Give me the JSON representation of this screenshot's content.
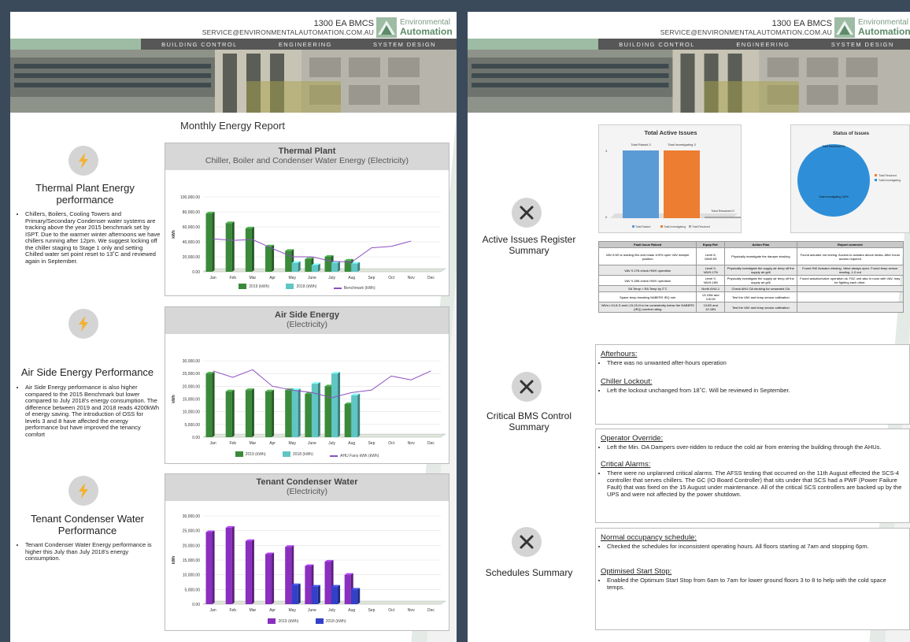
{
  "header": {
    "phone": "1300 EA BMCS",
    "email": "SERVICE@ENVIRONMENTALAUTOMATION.COM.AU",
    "logo_line1": "Environmental",
    "logo_line2": "Automation",
    "nav": [
      "BUILDING CONTROL",
      "ENGINEERING",
      "SYSTEM DESIGN"
    ]
  },
  "page1": {
    "title": "Monthly Energy Report",
    "sections": [
      {
        "icon": "lightning-icon",
        "title": "Thermal Plant Energy performance",
        "text": "Chillers, Boilers, Cooling Towers and Primary/Secondary Condenser water systems are tracking above the year 2015 benchmark set by ISPT. Due to the warmer winter afternoons we have chillers running after 12pm. We suggest locking off the chiller staging to Stage 1 only and setting Chilled water set point reset to 13˚C and reviewed again in September."
      },
      {
        "icon": "lightning-icon",
        "title": "Air Side Energy Performance",
        "text": "Air Side Energy performance is also higher compared to the 2015 Benchmark but lower compared to July 2018's energy consumption. The difference between 2019 and 2018 reads 4200kWh of energy saving. The introduction of OSS for levels 3 and 8 have affected the energy performance but have improved the tenancy comfort"
      },
      {
        "icon": "lightning-icon",
        "title": "Tenant Condenser Water Performance",
        "text": "Tenant Condenser Water Energy performance is higher this July than July 2018's energy consumption."
      }
    ]
  },
  "chart_data": [
    {
      "type": "bar",
      "title": "Thermal Plant",
      "subtitle": "Chiller, Boiler and Condenser Water Energy (Electricity)",
      "ylabel": "kWh",
      "ylim": [
        0,
        100000
      ],
      "yticks": [
        "100,000.00",
        "80,000.00",
        "60,000.00",
        "40,000.00",
        "20,000.00",
        "0.00"
      ],
      "categories": [
        "Jan",
        "Feb",
        "Mar",
        "Apr",
        "May",
        "June",
        "July",
        "Aug",
        "Sep",
        "Oct",
        "Nov",
        "Dec"
      ],
      "series": [
        {
          "name": "2019 (kWh)",
          "values": [
            78000,
            65000,
            58000,
            34000,
            28000,
            17000,
            20000,
            15000,
            null,
            null,
            null,
            null
          ],
          "color": "#3a8a3a"
        },
        {
          "name": "2018 (kWh)",
          "values": [
            null,
            null,
            null,
            null,
            12000,
            9000,
            12000,
            11000,
            null,
            null,
            null,
            null
          ],
          "color": "#5fc6c4"
        },
        {
          "name": "Benchmark (kWh)",
          "values": [
            44000,
            42000,
            43000,
            31000,
            20000,
            20000,
            14000,
            13000,
            32000,
            34000,
            41000,
            null
          ],
          "color": "#8b4fbf",
          "line": true
        }
      ],
      "legend": [
        "2019 (kWh)",
        "2018 (kWh)",
        "Benchmark (kWh)"
      ]
    },
    {
      "type": "bar",
      "title": "Air Side Energy",
      "subtitle": "(Electricity)",
      "ylabel": "kWh",
      "ylim": [
        0,
        30000
      ],
      "yticks": [
        "30,000.00",
        "25,000.00",
        "20,000.00",
        "15,000.00",
        "10,000.00",
        "5,000.00",
        "0.00"
      ],
      "categories": [
        "Jan",
        "Feb",
        "Mar",
        "Apr",
        "May",
        "June",
        "July",
        "Aug",
        "Sep",
        "Oct",
        "Nov",
        "Dec"
      ],
      "series": [
        {
          "name": "2019 (kWh)",
          "values": [
            25000,
            18000,
            18500,
            18000,
            18500,
            17000,
            20000,
            13000,
            null,
            null,
            null,
            null
          ],
          "color": "#3a8a3a"
        },
        {
          "name": "2018 (kWh)",
          "values": [
            null,
            null,
            null,
            null,
            18500,
            21000,
            25000,
            16500,
            null,
            null,
            null,
            null
          ],
          "color": "#5fc6c4"
        },
        {
          "name": "AHU Fans kWh (kWh)",
          "values": [
            26000,
            23500,
            26500,
            20000,
            18500,
            17500,
            15500,
            17500,
            18500,
            24000,
            22500,
            26000
          ],
          "color": "#8b4fbf",
          "line": true
        }
      ],
      "legend": [
        "2019 (kWh)",
        "2018 (kWh)",
        "AHU Fans kWh (kWh)"
      ]
    },
    {
      "type": "bar",
      "title": "Tenant Condenser Water",
      "subtitle": "(Electricity)",
      "ylabel": "kWh",
      "ylim": [
        0,
        30000
      ],
      "yticks": [
        "30,000.00",
        "25,000.00",
        "20,000.00",
        "15,000.00",
        "10,000.00",
        "5,000.00",
        "0.00"
      ],
      "categories": [
        "Jan",
        "Feb",
        "Mar",
        "Apr",
        "May",
        "June",
        "July",
        "Aug",
        "Sep",
        "Oct",
        "Nov",
        "Dec"
      ],
      "series": [
        {
          "name": "2019 (kWh)",
          "values": [
            24500,
            26000,
            21500,
            17000,
            19500,
            13000,
            14500,
            10000,
            null,
            null,
            null,
            null
          ],
          "color": "#8a2fbf"
        },
        {
          "name": "2018 (kWh)",
          "values": [
            null,
            null,
            null,
            null,
            6500,
            6000,
            6000,
            5000,
            null,
            null,
            null,
            null
          ],
          "color": "#3340c9"
        }
      ],
      "legend": [
        "2019 (kWh)",
        "2018 (kWh)"
      ]
    },
    {
      "type": "bar",
      "title": "Total Active Issues",
      "categories": [
        "Total Raised",
        "Total Investigating",
        "Total Resolved"
      ],
      "values": [
        3,
        3,
        0
      ],
      "data_labels": [
        "Total Raised 3",
        "Total Investigating 3",
        "Total Resolved 0"
      ],
      "colors": [
        "#5b9bd5",
        "#ed7d31",
        "#a5a5a5"
      ],
      "yticks": [
        "3",
        "0"
      ]
    },
    {
      "type": "pie",
      "title": "Status of Issues",
      "categories": [
        "Total Resolved",
        "Total Investigating"
      ],
      "values": [
        0,
        100
      ],
      "data_labels": [
        "Total Resolved 0%",
        "Total Investigating 100%"
      ],
      "colors": [
        "#ed7d31",
        "#2e8fd8"
      ]
    }
  ],
  "page2": {
    "sections": [
      {
        "title": "Active Issues Register Summary"
      },
      {
        "title": "Critical BMS Control Summary"
      },
      {
        "title": "Schedules Summary"
      }
    ],
    "table": {
      "headers": [
        "Fault Issue Raised",
        "Equip Ref.",
        "Action Plan",
        "Report comment"
      ],
      "rows": [
        [
          "VAV 8.6S is reading 0l/s and reads 100% open VAV damper position",
          "Level 8, VAV8.6S",
          "Physically investigate the damper stroking",
          "Found actuator not driving. Access to actuator above desks. After hours access required"
        ],
        [
          "VAV 9.17N check HWV operation",
          "Level 9, VAV9.17N",
          "Physically investigate the supply air temp off the supply air grill",
          "Found HW Actuator missing. Valve always open. Found temp sensor reading -1.0 out"
        ],
        [
          "VAV 9.18N check HWV operation",
          "Level 9, VAV9.18N",
          "Physically investigate the supply air temp off the supply air grill",
          "Found actuator/valve operation ok. FAC unit also in room with VAV, may be fighting each other."
        ],
        [
          "SA Temp < RA Temp by 2˚C",
          "North AHU-1",
          "Check AHU OA stroking for unwanted OA",
          ""
        ],
        [
          "Space temp breaking NABERS IEQ rule",
          "13.15W and 3.5CW",
          "Test the VAV and temp sensor calibration",
          ""
        ],
        [
          "VAVs L10-8-S and L15-15-N to be consistently below the NABERS (IEQ) comfort rating",
          "10.8S and 10.15N",
          "Test the VAV and temp sensor calibration",
          ""
        ]
      ]
    },
    "boxes": [
      {
        "items": [
          {
            "heading": "Afterhours:",
            "text": "There was no unwanted after-hours operation"
          },
          {
            "heading": "Chiller Lockout:",
            "text": "Left the lockout unchanged from 18˚C. Will be reviewed in September."
          }
        ]
      },
      {
        "items": [
          {
            "heading": "Operator Override:",
            "text": "Left the Min. OA Dampers over-ridden to reduce the cold air from entering the building through the AHUs."
          },
          {
            "heading": "Critical Alarms:",
            "text": "There were no unplanned critical alarms. The AFSS testing that occurred on the 11th August effected the SCS-4 controller that serves chillers. The GC (IO Board Controller) that sits under that SCS had a PWF (Power Failure Fault) that was fixed on the 15 August under maintenance.  All of the critical SCS controllers are backed up by the UPS and were not affected by the power shutdown."
          }
        ]
      },
      {
        "items": [
          {
            "heading": "Normal occupancy schedule:",
            "text": "Checked the schedules for inconsistent operating hours. All floors starting at 7am and stopping 6pm."
          },
          {
            "heading": "Optimised Start Stop:",
            "text": "Enabled the Optimum Start Stop from 6am to 7am for lower ground floors 3 to 8 to help with the cold space temps."
          }
        ]
      }
    ]
  }
}
